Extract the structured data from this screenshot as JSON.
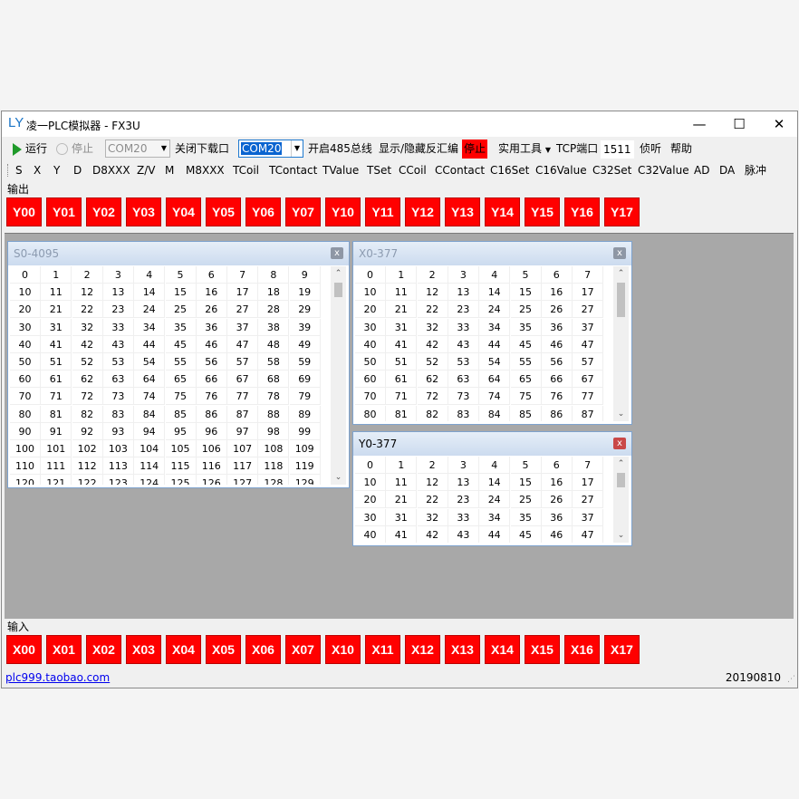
{
  "window": {
    "logo": "LY",
    "title": "凌一PLC模拟器 - FX3U",
    "controls": [
      "—",
      "☐",
      "✕"
    ]
  },
  "toolbar": {
    "run_label": "运行",
    "stop_label": "停止",
    "com_left": "COM20",
    "close_download_label": "关闭下载口",
    "com_right": "COM20",
    "open485_label": "开启485总线",
    "show_hide_label": "显示/隐藏反汇编",
    "stop_red_label": "停止",
    "tools_label": "实用工具",
    "tcp_label": "TCP端口",
    "tcp_port": "1511",
    "listen_label": "侦听",
    "help_label": "帮助"
  },
  "registers": [
    "S",
    "X",
    "Y",
    "D",
    "D8XXX",
    "Z/V",
    "M",
    "M8XXX",
    "TCoil",
    "TContact",
    "TValue",
    "TSet",
    "CCoil",
    "CContact",
    "C16Set",
    "C16Value",
    "C32Set",
    "C32Value",
    "AD",
    "DA",
    "脉冲"
  ],
  "outputs": {
    "label": "输出",
    "items": [
      "Y00",
      "Y01",
      "Y02",
      "Y03",
      "Y04",
      "Y05",
      "Y06",
      "Y07",
      "Y10",
      "Y11",
      "Y12",
      "Y13",
      "Y14",
      "Y15",
      "Y16",
      "Y17"
    ]
  },
  "inputs": {
    "label": "输入",
    "items": [
      "X00",
      "X01",
      "X02",
      "X03",
      "X04",
      "X05",
      "X06",
      "X07",
      "X10",
      "X11",
      "X12",
      "X13",
      "X14",
      "X15",
      "X16",
      "X17"
    ]
  },
  "windows": {
    "s": {
      "title": "S0-4095",
      "close": "x"
    },
    "x": {
      "title": "X0-377",
      "close": "x"
    },
    "y": {
      "title": "Y0-377",
      "close": "x"
    }
  },
  "scroll_arrows": {
    "up": "⌃",
    "down": "⌄"
  },
  "status": {
    "link": "plc999.taobao.com",
    "version": "20190810"
  }
}
